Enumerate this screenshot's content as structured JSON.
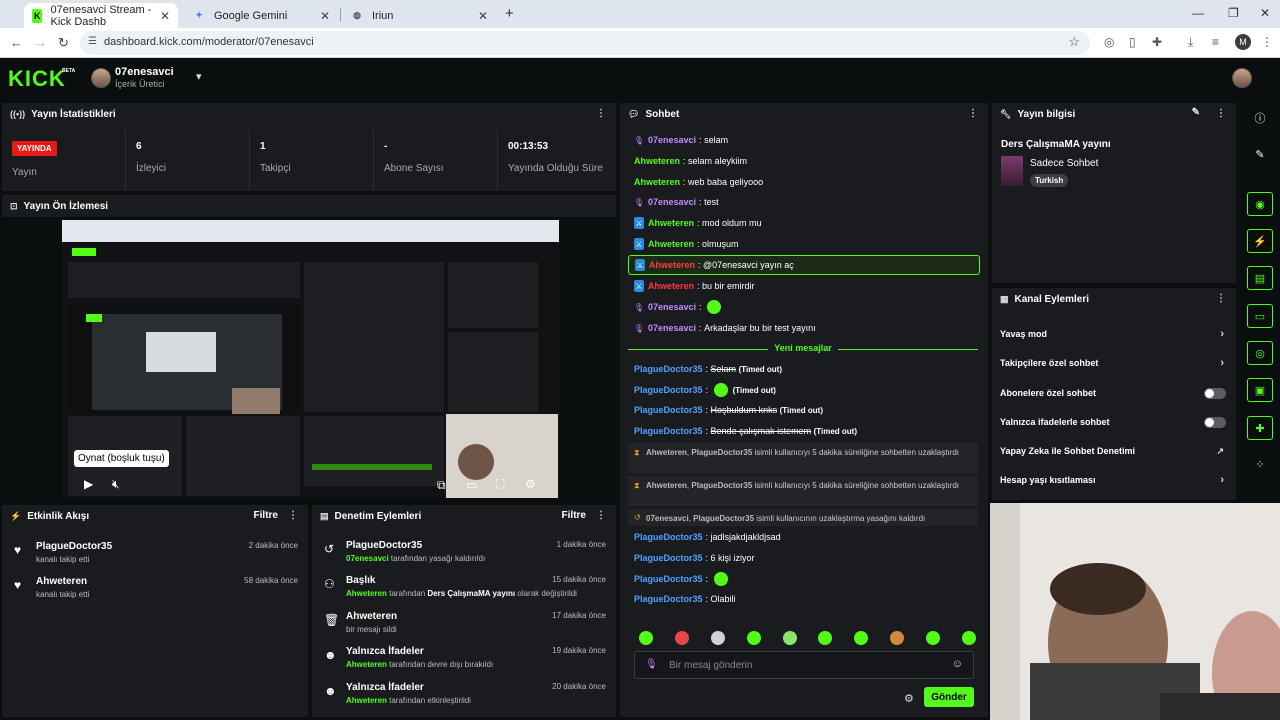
{
  "browser": {
    "tabs": [
      {
        "title": "07enesavci Stream - Kick Dashb"
      },
      {
        "title": "Google Gemini"
      },
      {
        "title": "Iriun"
      }
    ],
    "url": "dashboard.kick.com/moderator/07enesavci",
    "profile_initial": "M"
  },
  "header": {
    "logo": "KICK",
    "beta": "BETA",
    "channel_name": "07enesavci",
    "channel_role": "İçerik Üretici"
  },
  "stats": {
    "title": "Yayın İstatistikleri",
    "live_badge": "YAYINDA",
    "live_label": "Yayın",
    "viewers_value": "6",
    "viewers_label": "İzleyici",
    "followers_value": "1",
    "followers_label": "Takipçi",
    "subs_value": "-",
    "subs_label": "Abone Sayısı",
    "uptime_value": "00:13:53",
    "uptime_label": "Yayında Olduğu Süre"
  },
  "preview": {
    "title": "Yayın Ön İzlemesi",
    "tooltip": "Oynat (boşluk tuşu)"
  },
  "activity": {
    "title": "Etkinlik Akışı",
    "filter": "Filtre",
    "items": [
      {
        "name": "PlagueDoctor35",
        "sub": "kanalı takip etti",
        "time": "2 dakika önce"
      },
      {
        "name": "Ahweteren",
        "sub": "kanalı takip etti",
        "time": "58 dakika önce"
      }
    ]
  },
  "modactions": {
    "title": "Denetim Eylemleri",
    "filter": "Filtre",
    "items": [
      {
        "name": "PlagueDoctor35",
        "actor": "07enesavci",
        "rest": " tarafından yasağı kaldırıldı",
        "time": "1 dakika önce"
      },
      {
        "name": "Başlık",
        "actor": "Ahweteren",
        "mid": " tarafından ",
        "title": "Ders ÇalışmaMA yayını",
        "rest": " olarak değiştirildi",
        "time": "15 dakika önce"
      },
      {
        "name": "Ahweteren",
        "plain": "bir mesajı sildi",
        "time": "17 dakika önce"
      },
      {
        "name": "Yalnızca İfadeler",
        "actor": "Ahweteren",
        "rest": " tarafından devre dışı bırakıldı",
        "time": "19 dakika önce"
      },
      {
        "name": "Yalnızca İfadeler",
        "actor": "Ahweteren",
        "rest": " tarafından etkinleştirildi",
        "time": "20 dakika önce"
      }
    ]
  },
  "chat": {
    "title": "Sohbet",
    "new_messages": "Yeni mesajlar",
    "messages": [
      {
        "user": "07enesavci",
        "text": "selam"
      },
      {
        "user": "Ahweteren",
        "text": "selam aleykiim"
      },
      {
        "user": "Ahweteren",
        "text": "web baba geliyooo"
      },
      {
        "user": "07enesavci",
        "text": "test"
      },
      {
        "user": "Ahweteren",
        "text": "mod oldum mu"
      },
      {
        "user": "Ahweteren",
        "text": "olmuşum"
      },
      {
        "user": "Ahweteren",
        "text": "@07enesavci yayın aç"
      },
      {
        "user": "Ahweteren",
        "text": "bu bir emirdir"
      },
      {
        "user": "07enesavci",
        "text": ""
      },
      {
        "user": "07enesavci",
        "text": "Arkadaşlar bu bir test yayını"
      },
      {
        "user": "PlagueDoctor35",
        "text": "Selam",
        "tag": "(Timed out)"
      },
      {
        "user": "PlagueDoctor35",
        "text": "",
        "tag": "(Timed out)"
      },
      {
        "user": "PlagueDoctor35",
        "text": "Hoşbuldum knks",
        "tag": "(Timed out)"
      },
      {
        "user": "PlagueDoctor35",
        "text": "Bende çalışmak istemem",
        "tag": "(Timed out)"
      },
      {
        "user": "PlagueDoctor35",
        "text": "jadlsjakdjakldjsad"
      },
      {
        "user": "PlagueDoctor35",
        "text": "6 kişi iziyor"
      },
      {
        "user": "PlagueDoctor35",
        "text": ""
      },
      {
        "user": "PlagueDoctor35",
        "text": "Olabili"
      }
    ],
    "system": [
      {
        "a": "Ahweteren",
        "b": "PlagueDoctor35",
        "text": " isimli kullanıcıyı 5 dakika süreliğine sohbetten uzaklaştırdı"
      },
      {
        "a": "Ahweteren",
        "b": "PlagueDoctor35",
        "text": " isimli kullanıcıyı 5 dakika süreliğine sohbetten uzaklaştırdı"
      },
      {
        "a": "07enesavci",
        "b": "PlagueDoctor35",
        "text": " isimli kullanıcının uzaklaştırma yasağını kaldırdı"
      }
    ],
    "input_placeholder": "Bir mesaj gönderin",
    "send": "Gönder"
  },
  "stream_info": {
    "title": "Yayın bilgisi",
    "stream_title": "Ders ÇalışmaMA yayını",
    "category": "Sadece Sohbet",
    "language": "Turkish"
  },
  "channel_actions": {
    "title": "Kanal Eylemleri",
    "items": [
      {
        "label": "Yavaş mod"
      },
      {
        "label": "Takipçilere özel sohbet"
      },
      {
        "label": "Abonelere özel sohbet"
      },
      {
        "label": "Yalnızca ifadelerle sohbet"
      },
      {
        "label": "Yapay Zeka ile Sohbet Denetimi"
      },
      {
        "label": "Hesap yaşı kısıtlaması"
      }
    ]
  },
  "colors": {
    "accent": "#53fc18",
    "live": "#e91916",
    "panel": "#191b1f"
  }
}
